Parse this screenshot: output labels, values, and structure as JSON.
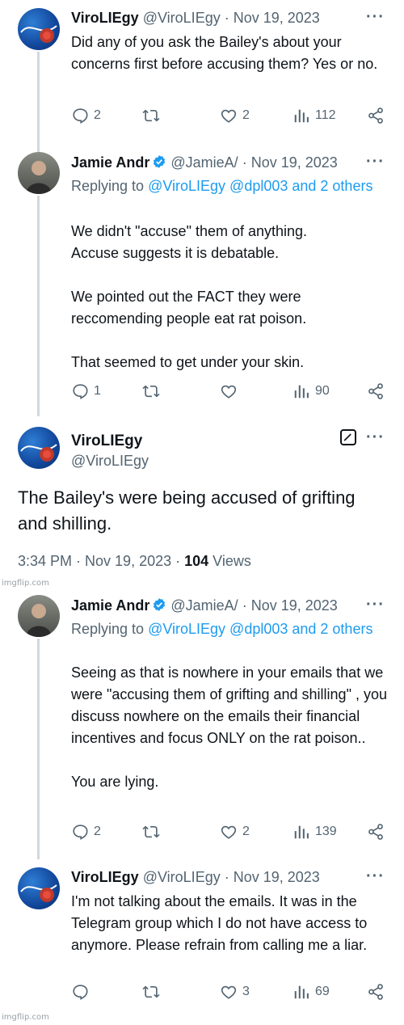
{
  "tweets": [
    {
      "name": "ViroLIEgy",
      "handle": "@ViroLIEgy",
      "date": "· Nov 19, 2023",
      "body": "Did any of you ask the Bailey's about your concerns first before accusing them? Yes or no.",
      "replies": "2",
      "likes": "2",
      "views": "112"
    },
    {
      "name": "Jamie Andr",
      "handle": "@JamieA/",
      "date": "· Nov 19, 2023",
      "replying_prefix": "Replying to ",
      "replying_users": "@ViroLIEgy @dpl003 and 2 others",
      "body": "We didn't \"accuse\" them of anything.\nAccuse suggests it is debatable.\n\nWe pointed out the FACT they were reccomending people eat rat poison.\n\nThat seemed to get under your skin.",
      "replies": "1",
      "likes": "",
      "views": "90"
    },
    {
      "name": "Jamie Andr",
      "handle": "@JamieA/",
      "date": "· Nov 19, 2023",
      "replying_prefix": "Replying to ",
      "replying_users": "@ViroLIEgy @dpl003 and 2 others",
      "body": "Seeing as that is nowhere in your emails that we were \"accusing them of grifting and shilling\" , you discuss nowhere on the emails their financial incentives and focus ONLY on the rat poison..\n\nYou are lying.",
      "replies": "2",
      "likes": "2",
      "views": "139"
    },
    {
      "name": "ViroLIEgy",
      "handle": "@ViroLIEgy",
      "date": "· Nov 19, 2023",
      "body": "I'm not talking about the emails. It was in the Telegram group which I do not have access to anymore. Please refrain from calling me a liar.",
      "replies": "",
      "likes": "3",
      "views": "69"
    }
  ],
  "focus": {
    "name": "ViroLIEgy",
    "handle": "@ViroLIEgy",
    "body": "The Bailey's were being accused of grifting and shilling.",
    "time": "3:34 PM · Nov 19, 2023 · ",
    "views_count": "104",
    "views_label": " Views"
  },
  "watermark": "imgflip.com",
  "icons": [
    "reply-icon",
    "retweet-icon",
    "like-icon",
    "views-icon",
    "share-icon",
    "more-icon",
    "verified-icon",
    "grok-icon"
  ],
  "colors": {
    "text": "#0f1419",
    "muted": "#536471",
    "link": "#1d9bf0",
    "verified": "#1d9bf0"
  }
}
